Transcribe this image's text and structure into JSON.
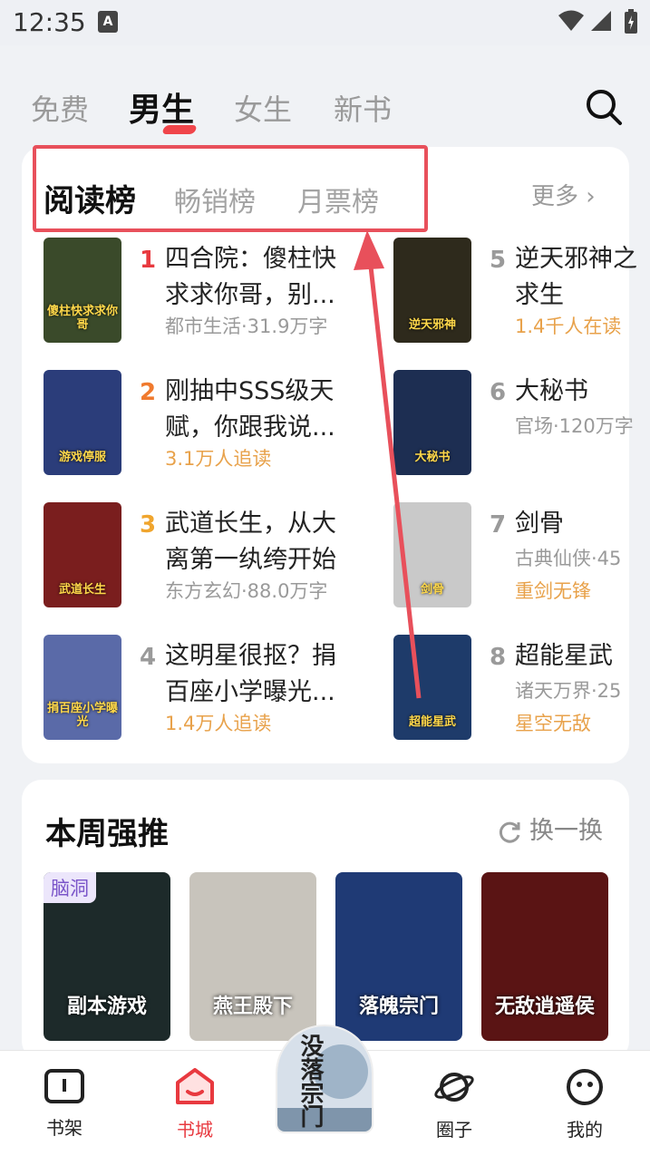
{
  "status": {
    "time": "12:35",
    "notif_icon": "A"
  },
  "top_tabs": [
    "免费",
    "男生",
    "女生",
    "新书"
  ],
  "top_tab_active": "男生",
  "rank_tabs": [
    "阅读榜",
    "畅销榜",
    "月票榜"
  ],
  "rank_more": "更多",
  "books_left": [
    {
      "rank": "1",
      "title1": "四合院：傻柱快",
      "title2": "求求你哥，别...",
      "meta": "都市生活·31.9万字",
      "meta_orange": false,
      "rank_color": "#e8393f",
      "cover_color": "#3a4a2a",
      "cover_text": "傻柱快求求你哥"
    },
    {
      "rank": "2",
      "title1": "刚抽中SSS级天",
      "title2": "赋，你跟我说...",
      "meta": "3.1万人追读",
      "meta_orange": true,
      "rank_color": "#f07a2e",
      "cover_color": "#2b3d7a",
      "cover_text": "游戏停服"
    },
    {
      "rank": "3",
      "title1": "武道长生，从大",
      "title2": "离第一纨绔开始",
      "meta": "东方玄幻·88.0万字",
      "meta_orange": false,
      "rank_color": "#f0a52e",
      "cover_color": "#7a1e1e",
      "cover_text": "武道长生"
    },
    {
      "rank": "4",
      "title1": "这明星很抠？捐",
      "title2": "百座小学曝光...",
      "meta": "1.4万人追读",
      "meta_orange": true,
      "rank_color": "#9a9a9a",
      "cover_color": "#5a6aa8",
      "cover_text": "捐百座小学曝光"
    }
  ],
  "books_right": [
    {
      "rank": "5",
      "title1": "逆天邪神之",
      "title2": "求生",
      "meta": "1.4千人在读",
      "meta_orange": true,
      "cover_color": "#2e2a1c",
      "cover_text": "逆天邪神"
    },
    {
      "rank": "6",
      "title1": "大秘书",
      "title2": "",
      "meta": "官场·120万字",
      "meta_orange": false,
      "cover_color": "#1d2e52",
      "cover_text": "大秘书"
    },
    {
      "rank": "7",
      "title1": "剑骨",
      "title2": "",
      "meta": "古典仙侠·45",
      "meta_orange": false,
      "meta2": "重剑无锋",
      "cover_color": "#c9c9c9",
      "cover_text": "剑骨"
    },
    {
      "rank": "8",
      "title1": "超能星武",
      "title2": "",
      "meta": "诸天万界·25",
      "meta_orange": false,
      "meta2": "星空无敌",
      "cover_color": "#1e3b6a",
      "cover_text": "超能星武"
    }
  ],
  "weekly": {
    "title": "本周强推",
    "refresh_label": "换一换",
    "tag": "脑洞",
    "covers": [
      {
        "text": "副本游戏",
        "color": "#1d2a2a"
      },
      {
        "text": "燕王殿下",
        "color": "#c8c4bc"
      },
      {
        "text": "落魄宗门",
        "color": "#1f3a75"
      },
      {
        "text": "无敌逍遥侯",
        "color": "#5a1414"
      }
    ]
  },
  "float_cover_text": "没落宗门",
  "nav": [
    "书架",
    "书城",
    "",
    "圈子",
    "我的"
  ],
  "nav_active": "书城",
  "colors": {
    "accent": "#e8393f",
    "highlight_box": "#e8505b",
    "arrow": "#e8505b"
  }
}
